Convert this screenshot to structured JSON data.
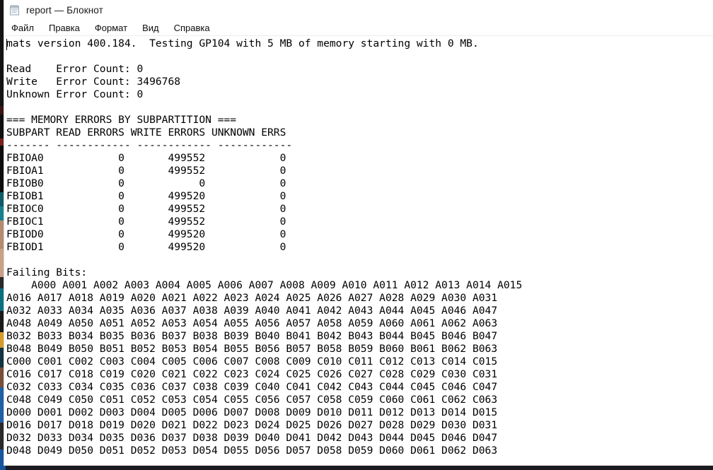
{
  "window": {
    "icon": "notepad-icon",
    "title": "report — Блокнот",
    "document_name": "report",
    "app_name": "Блокнот"
  },
  "menu": {
    "items": [
      {
        "label": "Файл"
      },
      {
        "label": "Правка"
      },
      {
        "label": "Формат"
      },
      {
        "label": "Вид"
      },
      {
        "label": "Справка"
      }
    ]
  },
  "document": {
    "header_line": "mats version 400.184.  Testing GP104 with 5 MB of memory starting with 0 MB.",
    "mats_version": "400.184",
    "chip": "GP104",
    "memory_tested_mb": "5",
    "memory_start_mb": "0",
    "error_counts": [
      {
        "label": "Read   ",
        "text": "Error Count:",
        "value": "0"
      },
      {
        "label": "Write  ",
        "text": "Error Count:",
        "value": "3496768"
      },
      {
        "label": "Unknown",
        "text": "Error Count:",
        "value": "0"
      }
    ],
    "subpartition_section": {
      "heading": "=== MEMORY ERRORS BY SUBPARTITION ===",
      "columns": [
        "SUBPART",
        "READ ERRORS",
        "WRITE ERRORS",
        "UNKNOWN ERRS"
      ],
      "rule": [
        "-------",
        "------------",
        "------------",
        "------------"
      ],
      "rows": [
        {
          "subpart": "FBIOA0",
          "read_errors": "0",
          "write_errors": "499552",
          "unknown_errs": "0"
        },
        {
          "subpart": "FBIOA1",
          "read_errors": "0",
          "write_errors": "499552",
          "unknown_errs": "0"
        },
        {
          "subpart": "FBIOB0",
          "read_errors": "0",
          "write_errors": "0",
          "unknown_errs": "0"
        },
        {
          "subpart": "FBIOB1",
          "read_errors": "0",
          "write_errors": "499520",
          "unknown_errs": "0"
        },
        {
          "subpart": "FBIOC0",
          "read_errors": "0",
          "write_errors": "499552",
          "unknown_errs": "0"
        },
        {
          "subpart": "FBIOC1",
          "read_errors": "0",
          "write_errors": "499552",
          "unknown_errs": "0"
        },
        {
          "subpart": "FBIOD0",
          "read_errors": "0",
          "write_errors": "499520",
          "unknown_errs": "0"
        },
        {
          "subpart": "FBIOD1",
          "read_errors": "0",
          "write_errors": "499520",
          "unknown_errs": "0"
        }
      ]
    },
    "failing_bits": {
      "heading": "Failing Bits:",
      "lines": [
        "    A000 A001 A002 A003 A004 A005 A006 A007 A008 A009 A010 A011 A012 A013 A014 A015",
        "A016 A017 A018 A019 A020 A021 A022 A023 A024 A025 A026 A027 A028 A029 A030 A031",
        "A032 A033 A034 A035 A036 A037 A038 A039 A040 A041 A042 A043 A044 A045 A046 A047",
        "A048 A049 A050 A051 A052 A053 A054 A055 A056 A057 A058 A059 A060 A061 A062 A063",
        "B032 B033 B034 B035 B036 B037 B038 B039 B040 B041 B042 B043 B044 B045 B046 B047",
        "B048 B049 B050 B051 B052 B053 B054 B055 B056 B057 B058 B059 B060 B061 B062 B063",
        "C000 C001 C002 C003 C004 C005 C006 C007 C008 C009 C010 C011 C012 C013 C014 C015",
        "C016 C017 C018 C019 C020 C021 C022 C023 C024 C025 C026 C027 C028 C029 C030 C031",
        "C032 C033 C034 C035 C036 C037 C038 C039 C040 C041 C042 C043 C044 C045 C046 C047",
        "C048 C049 C050 C051 C052 C053 C054 C055 C056 C057 C058 C059 C060 C061 C062 C063",
        "D000 D001 D002 D003 D004 D005 D006 D007 D008 D009 D010 D011 D012 D013 D014 D015",
        "D016 D017 D018 D019 D020 D021 D022 D023 D024 D025 D026 D027 D028 D029 D030 D031",
        "D032 D033 D034 D035 D036 D037 D038 D039 D040 D041 D042 D043 D044 D045 D046 D047",
        "D048 D049 D050 D051 D052 D053 D054 D055 D056 D057 D058 D059 D060 D061 D062 D063"
      ]
    },
    "full_text": "mats version 400.184.  Testing GP104 with 5 MB of memory starting with 0 MB.\n\nRead    Error Count: 0\nWrite   Error Count: 3496768\nUnknown Error Count: 0\n\n=== MEMORY ERRORS BY SUBPARTITION ===\nSUBPART READ ERRORS WRITE ERRORS UNKNOWN ERRS\n------- ------------ ------------ ------------\nFBIOA0            0       499552            0\nFBIOA1            0       499552            0\nFBIOB0            0            0            0\nFBIOB1            0       499520            0\nFBIOC0            0       499552            0\nFBIOC1            0       499552            0\nFBIOD0            0       499520            0\nFBIOD1            0       499520            0\n\nFailing Bits:\n    A000 A001 A002 A003 A004 A005 A006 A007 A008 A009 A010 A011 A012 A013 A014 A015\nA016 A017 A018 A019 A020 A021 A022 A023 A024 A025 A026 A027 A028 A029 A030 A031\nA032 A033 A034 A035 A036 A037 A038 A039 A040 A041 A042 A043 A044 A045 A046 A047\nA048 A049 A050 A051 A052 A053 A054 A055 A056 A057 A058 A059 A060 A061 A062 A063\nB032 B033 B034 B035 B036 B037 B038 B039 B040 B041 B042 B043 B044 B045 B046 B047\nB048 B049 B050 B051 B052 B053 B054 B055 B056 B057 B058 B059 B060 B061 B062 B063\nC000 C001 C002 C003 C004 C005 C006 C007 C008 C009 C010 C011 C012 C013 C014 C015\nC016 C017 C018 C019 C020 C021 C022 C023 C024 C025 C026 C027 C028 C029 C030 C031\nC032 C033 C034 C035 C036 C037 C038 C039 C040 C041 C042 C043 C044 C045 C046 C047\nC048 C049 C050 C051 C052 C053 C054 C055 C056 C057 C058 C059 C060 C061 C062 C063\nD000 D001 D002 D003 D004 D005 D006 D007 D008 D009 D010 D011 D012 D013 D014 D015\nD016 D017 D018 D019 D020 D021 D022 D023 D024 D025 D026 D027 D028 D029 D030 D031\nD032 D033 D034 D035 D036 D037 D038 D039 D040 D041 D042 D043 D044 D045 D046 D047\nD048 D049 D050 D051 D052 D053 D054 D055 D056 D057 D058 D059 D060 D061 D062 D063"
  }
}
